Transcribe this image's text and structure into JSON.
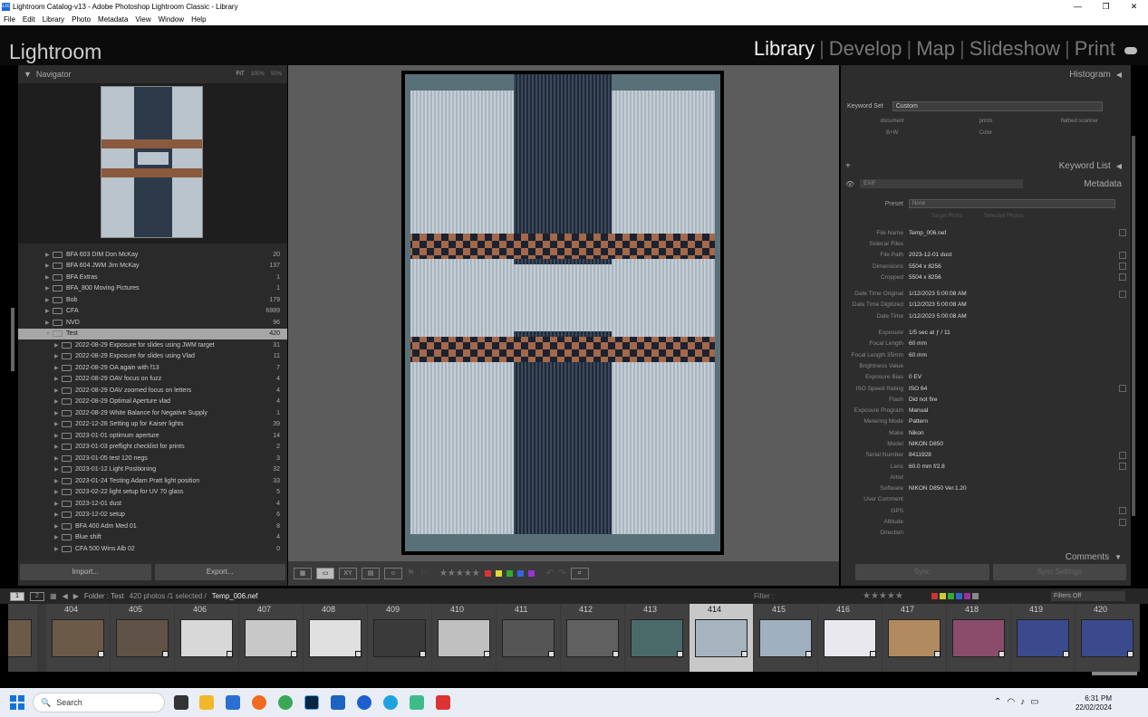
{
  "window": {
    "title": "Lightroom Catalog-v13 - Adobe Photoshop Lightroom Classic - Library",
    "app_icon": "Lrc"
  },
  "menu": [
    "File",
    "Edit",
    "Library",
    "Photo",
    "Metadata",
    "View",
    "Window",
    "Help"
  ],
  "identity": {
    "logo": "Lightroom",
    "modules": [
      "Library",
      "Develop",
      "Map",
      "Slideshow",
      "Print"
    ],
    "active_module": "Library"
  },
  "navigator": {
    "title": "Navigator",
    "zoom": [
      "FIT",
      "100%",
      "50%"
    ]
  },
  "folders": [
    {
      "name": "BFA 603 DIM Don McKay",
      "count": "20",
      "level": 1
    },
    {
      "name": "BFA 604 JWM Jim McKay",
      "count": "137",
      "level": 1
    },
    {
      "name": "BFA Extras",
      "count": "1",
      "level": 1
    },
    {
      "name": "BFA_800 Moving Pictures",
      "count": "1",
      "level": 1
    },
    {
      "name": "Bob",
      "count": "179",
      "level": 1
    },
    {
      "name": "CFA",
      "count": "6889",
      "level": 1
    },
    {
      "name": "NVD",
      "count": "96",
      "level": 1
    },
    {
      "name": "Test",
      "count": "420",
      "level": 1,
      "selected": true
    },
    {
      "name": "2022-08-29 Exposure for slides using JWM target",
      "count": "31",
      "level": 2
    },
    {
      "name": "2022-08-29 Exposure for slides using Vlad",
      "count": "11",
      "level": 2
    },
    {
      "name": "2022-08-29 OA again with f13",
      "count": "7",
      "level": 2
    },
    {
      "name": "2022-08-29 OAV focus on fuzz",
      "count": "4",
      "level": 2
    },
    {
      "name": "2022-08-29 OAV zoomed focus on letters",
      "count": "4",
      "level": 2
    },
    {
      "name": "2022-08-29 Optimal Aperture vlad",
      "count": "4",
      "level": 2
    },
    {
      "name": "2022-08-29 White Balance for Negative Supply",
      "count": "1",
      "level": 2
    },
    {
      "name": "2022-12-28 Setting up for Kaiser lights",
      "count": "39",
      "level": 2
    },
    {
      "name": "2023-01-01 optimum aperture",
      "count": "14",
      "level": 2
    },
    {
      "name": "2023-01-03 preflight checklist for prints",
      "count": "2",
      "level": 2
    },
    {
      "name": "2023-01-05 test 120 negs",
      "count": "3",
      "level": 2
    },
    {
      "name": "2023-01-12 Light Positioning",
      "count": "32",
      "level": 2
    },
    {
      "name": "2023-01-24 Testing Adam Pratt light position",
      "count": "33",
      "level": 2
    },
    {
      "name": "2023-02-22 light setup for UV 70 glass",
      "count": "5",
      "level": 2
    },
    {
      "name": "2023-12-01 dust",
      "count": "4",
      "level": 2
    },
    {
      "name": "2023-12-02 setup",
      "count": "6",
      "level": 2
    },
    {
      "name": "BFA 400 Adm Med 01",
      "count": "8",
      "level": 2
    },
    {
      "name": "Blue shift",
      "count": "4",
      "level": 2
    },
    {
      "name": "CFA 500 Wins Alb 02",
      "count": "0",
      "level": 2
    }
  ],
  "left_buttons": {
    "import": "Import...",
    "export": "Export..."
  },
  "right_panel": {
    "histogram": "Histogram",
    "keyword_set_label": "Keyword Set",
    "keyword_set_value": "Custom",
    "keywords": [
      "document",
      "prints",
      "flatbed scanner",
      "B+W",
      "Color",
      ""
    ],
    "keyword_list": "Keyword List",
    "metadata_title": "Metadata",
    "metadata_preset_value": "EXIF",
    "preset_label": "Preset",
    "preset_value": "None",
    "target_photo": "Target Photo",
    "selected_photos": "Selected Photos",
    "comments": "Comments",
    "sync": "Sync",
    "sync_settings": "Sync Settings"
  },
  "metadata": [
    {
      "k": "File Name",
      "v": "Temp_006.nef",
      "box": true
    },
    {
      "k": "Sidecar Files",
      "v": ""
    },
    {
      "k": "File Path",
      "v": "2023-12-01 dust",
      "box": true
    },
    {
      "k": "Dimensions",
      "v": "5504 x 8256",
      "box": true
    },
    {
      "k": "Cropped",
      "v": "5504 x 8256",
      "box": true
    },
    {
      "k": "Date Time Original",
      "v": "1/12/2023 5:00:08 AM",
      "box": true,
      "gap": true
    },
    {
      "k": "Date Time Digitized",
      "v": "1/12/2023 5:00:08 AM"
    },
    {
      "k": "Date Time",
      "v": "1/12/2023 5:00:08 AM"
    },
    {
      "k": "Exposure",
      "v": "1/5 sec at ƒ / 11",
      "gap": true
    },
    {
      "k": "Focal Length",
      "v": "60 mm"
    },
    {
      "k": "Focal Length 35mm",
      "v": "60 mm"
    },
    {
      "k": "Brightness Value",
      "v": ""
    },
    {
      "k": "Exposure Bias",
      "v": "0 EV"
    },
    {
      "k": "ISO Speed Rating",
      "v": "ISO 64",
      "box": true
    },
    {
      "k": "Flash",
      "v": "Did not fire"
    },
    {
      "k": "Exposure Program",
      "v": "Manual"
    },
    {
      "k": "Metering Mode",
      "v": "Pattern"
    },
    {
      "k": "Make",
      "v": "Nikon"
    },
    {
      "k": "Model",
      "v": "NIKON D850"
    },
    {
      "k": "Serial Number",
      "v": "8411928",
      "box": true
    },
    {
      "k": "Lens",
      "v": "60.0 mm f/2.8",
      "box": true
    },
    {
      "k": "Artist",
      "v": ""
    },
    {
      "k": "Software",
      "v": "NIKON D850 Ver.1.20"
    },
    {
      "k": "User Comment",
      "v": ""
    },
    {
      "k": "GPS",
      "v": "",
      "box": true
    },
    {
      "k": "Altitude",
      "v": "",
      "box": true
    },
    {
      "k": "Direction",
      "v": ""
    }
  ],
  "filmbar": {
    "screen1": "1",
    "screen2": "2",
    "source": "Folder : Test",
    "info": "420 photos /1 selected /",
    "current": "Temp_006.nef",
    "filter_label": "Filter :",
    "filters_off": "Filters Off"
  },
  "filmstrip": [
    "404",
    "405",
    "406",
    "407",
    "408",
    "409",
    "410",
    "411",
    "412",
    "413",
    "414",
    "415",
    "416",
    "417",
    "418",
    "419",
    "420"
  ],
  "filmstrip_selected": "414",
  "taskbar": {
    "search": "Search",
    "time": "6:31 PM",
    "date": "22/02/2024"
  }
}
